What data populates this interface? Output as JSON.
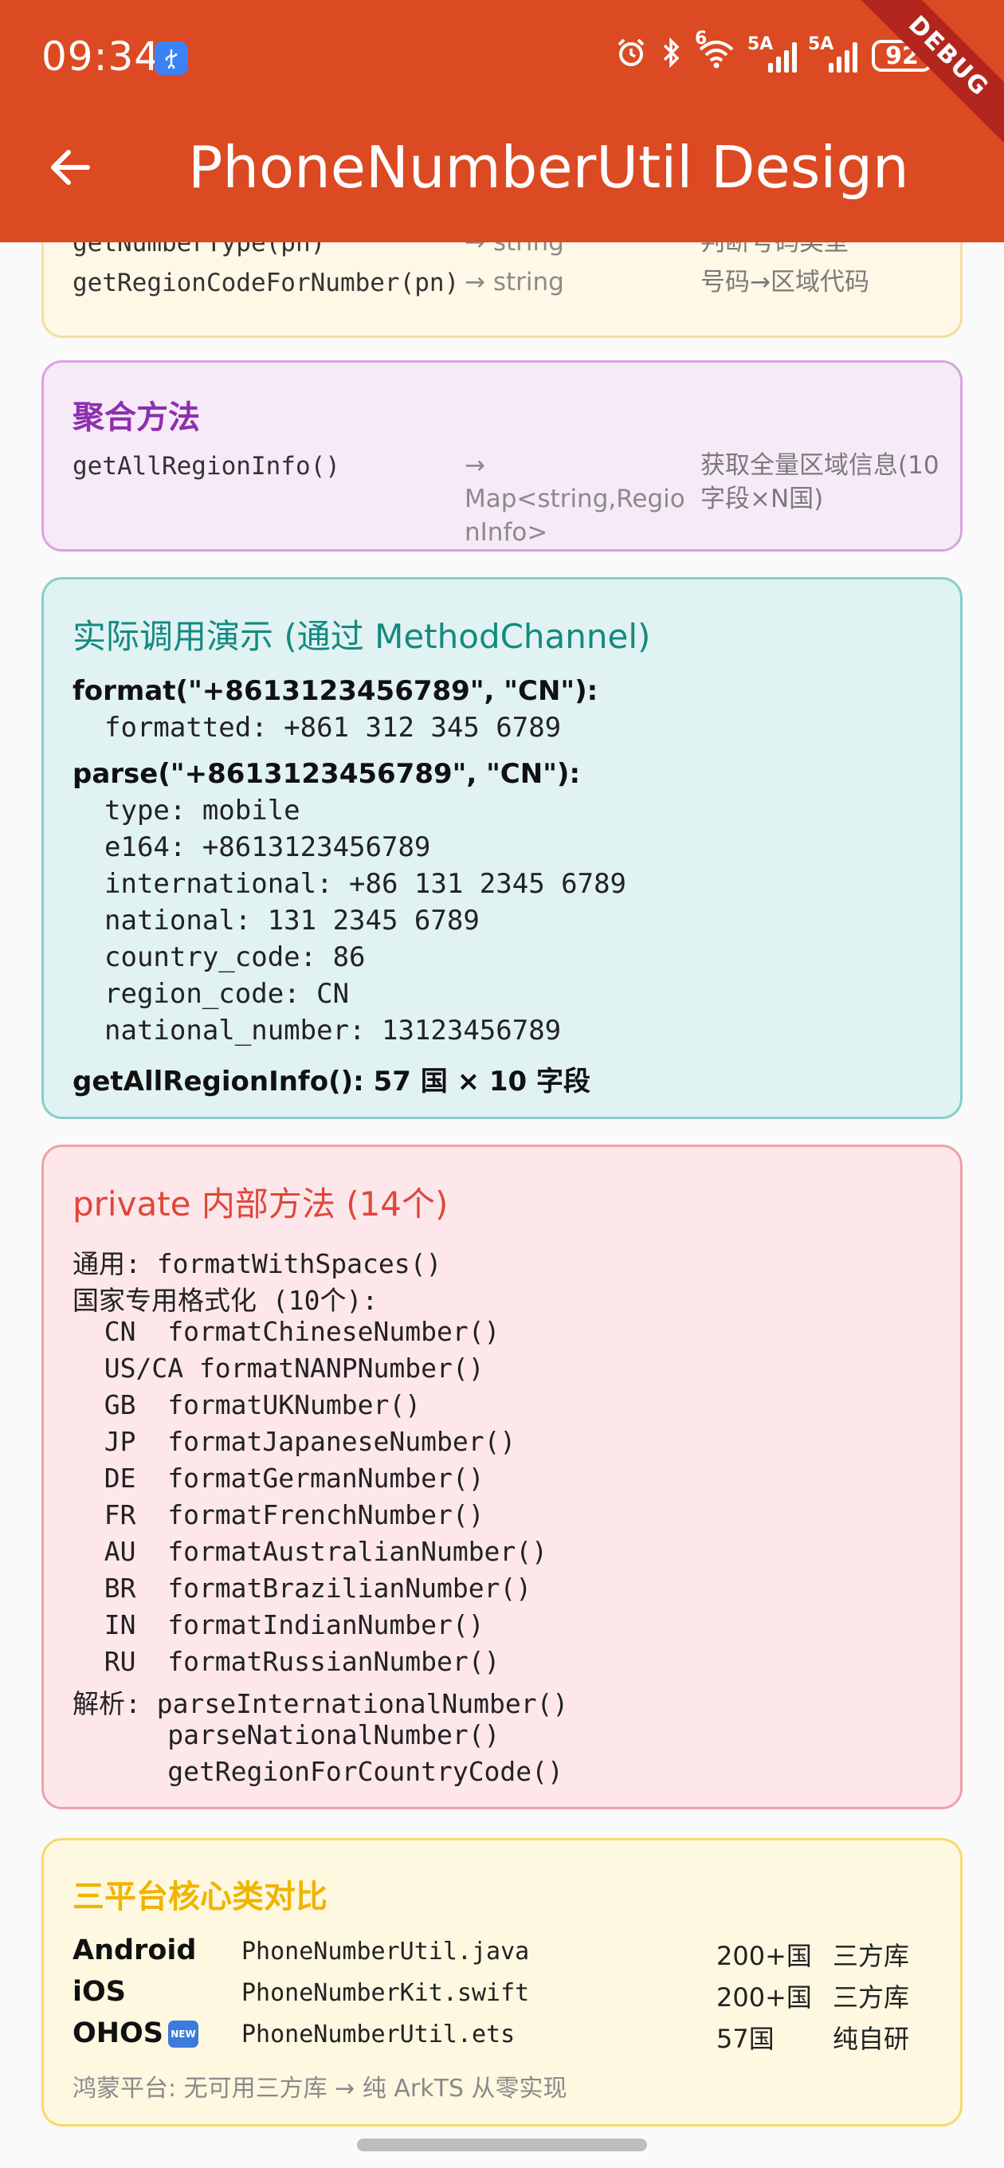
{
  "status_bar": {
    "time": "09:34",
    "network_5g_label": "6",
    "sim1_label": "5A",
    "sim2_label": "5A",
    "battery": "92",
    "debug_label": "DEBUG"
  },
  "app_bar": {
    "title": "PhoneNumberUtil Design"
  },
  "lookup_card": {
    "rows": [
      {
        "name": "getNumberType(pn)",
        "ret": "→ string",
        "desc": "判断号码类型"
      },
      {
        "name": "getRegionCodeForNumber(pn)",
        "ret": "→ string",
        "desc": "号码→区域代码"
      }
    ],
    "colors": {
      "bg": "#fff8e6",
      "border": "#f6dca4"
    }
  },
  "aggregate_card": {
    "title": "聚合方法",
    "name": "getAllRegionInfo()",
    "ret_line1": "→ Map<string,Regio",
    "ret_line2": "nInfo>",
    "desc_line1": "获取全量区域信息(10",
    "desc_line2": "字段×N国)",
    "colors": {
      "title": "#8e2fb0",
      "bg": "#f7eaf8",
      "border": "#d9a3e0"
    }
  },
  "demo_card": {
    "title": "实际调用演示 (通过 MethodChannel)",
    "format_call": "format(\"+8613123456789\", \"CN\"):",
    "formatted": "formatted: +861 312 345 6789",
    "parse_call": "parse(\"+8613123456789\", \"CN\"):",
    "parse_results": [
      "type: mobile",
      "e164: +8613123456789",
      "international: +86 131 2345 6789",
      "national: 131 2345 6789",
      "country_code: 86",
      "region_code: CN",
      "national_number: 13123456789"
    ],
    "summary": "getAllRegionInfo(): 57 国 × 10 字段",
    "colors": {
      "title": "#138a80",
      "bg": "#e1f2f3",
      "border": "#86cfca"
    }
  },
  "private_card": {
    "title": "private 内部方法 (14个)",
    "lines": [
      "通用: formatWithSpaces()",
      "国家专用格式化 (10个):",
      "  CN  formatChineseNumber()",
      "  US/CA formatNANPNumber()",
      "  GB  formatUKNumber()",
      "  JP  formatJapaneseNumber()",
      "  DE  formatGermanNumber()",
      "  FR  formatFrenchNumber()",
      "  AU  formatAustralianNumber()",
      "  BR  formatBrazilianNumber()",
      "  IN  formatIndianNumber()",
      "  RU  formatRussianNumber()",
      "解析: parseInternationalNumber()",
      "      parseNationalNumber()",
      "      getRegionForCountryCode()"
    ],
    "colors": {
      "title": "#e0463a",
      "bg": "#fde7ea",
      "border": "#eea0a8"
    }
  },
  "compare_card": {
    "title": "三平台核心类对比",
    "rows": [
      {
        "platform": "Android",
        "file": "PhoneNumberUtil.java",
        "count": "200+国",
        "kind": "三方库"
      },
      {
        "platform": "iOS",
        "file": "PhoneNumberKit.swift",
        "count": "200+国",
        "kind": "三方库"
      },
      {
        "platform": "OHOS",
        "file": "PhoneNumberUtil.ets",
        "count": "57国",
        "kind": "纯自研"
      }
    ],
    "new_badge": "NEW",
    "footer": "鸿蒙平台: 无可用三方库 → 纯 ArkTS 从零实现",
    "colors": {
      "title": "#f0b400",
      "bg": "#fff8e1",
      "border": "#f7d96a"
    }
  }
}
